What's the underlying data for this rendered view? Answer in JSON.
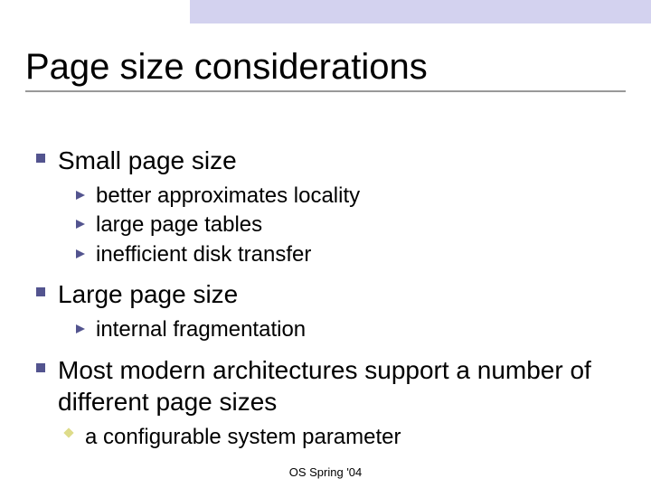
{
  "title": "Page size considerations",
  "bullets": {
    "b1": "Small page size",
    "b1_sub": [
      "better approximates locality",
      "large page tables",
      "inefficient disk transfer"
    ],
    "b2": "Large page size",
    "b2_sub": [
      "internal fragmentation"
    ],
    "b3": "Most modern architectures support a number of different page sizes",
    "b3_sub": [
      "a configurable system parameter"
    ]
  },
  "footer": "OS Spring '04"
}
